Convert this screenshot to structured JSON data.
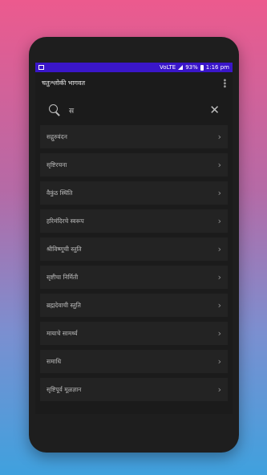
{
  "statusbar": {
    "battery": "93%",
    "time": "1:16 pm",
    "network": "VoLTE"
  },
  "app": {
    "title": "चतुःश्लोकी भागवत"
  },
  "search": {
    "query": "स"
  },
  "list": [
    {
      "label": "सद्गुरुवंदन"
    },
    {
      "label": "सृष्टिरचना"
    },
    {
      "label": "वैकुंठ स्थिति"
    },
    {
      "label": "हरिमंदिरचे स्वरूप"
    },
    {
      "label": "श्रीविष्णूची स्तुति"
    },
    {
      "label": "सृष्टीचा निर्मिती"
    },
    {
      "label": "ब्रह्मदेवाची स्तुति"
    },
    {
      "label": "मायाचे सामर्थ्य"
    },
    {
      "label": "समाधि"
    },
    {
      "label": "सृष्टिपूर्व मूळज्ञान"
    }
  ]
}
